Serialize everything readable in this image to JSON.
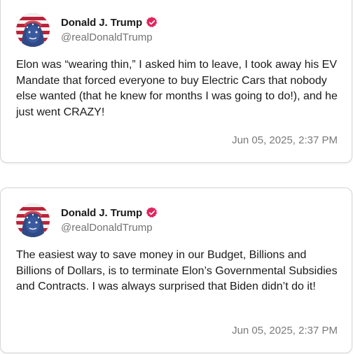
{
  "posts": [
    {
      "author": {
        "name": "Donald J. Trump",
        "handle": "@realDonaldTrump",
        "verified": true
      },
      "text": "Elon was “wearing thin,” I asked him to leave, I took away his EV Mandate that forced everyone to buy Electric Cars that nobody else wanted (that he knew for months I was going to do!), and he just went CRAZY!",
      "timestamp": "Jun 05, 2025, 2:37 PM"
    },
    {
      "author": {
        "name": "Donald J. Trump",
        "handle": "@realDonaldTrump",
        "verified": true
      },
      "text": "The easiest way to save money in our Budget, Billions and Billions of Dollars, is to terminate Elon’s Governmental Subsidies and Contracts. I was always surprised that Biden didn’t do it!",
      "timestamp": "Jun 05, 2025, 2:37 PM"
    }
  ],
  "colors": {
    "verified_badge": "#e0245e",
    "handle": "#737373",
    "timestamp": "#7a7a7a",
    "text": "#1a1a1a",
    "card_border": "#d6d6d6"
  },
  "icons": {
    "avatar": "flag-painted-portrait-avatar",
    "verified": "verified-badge-icon"
  }
}
